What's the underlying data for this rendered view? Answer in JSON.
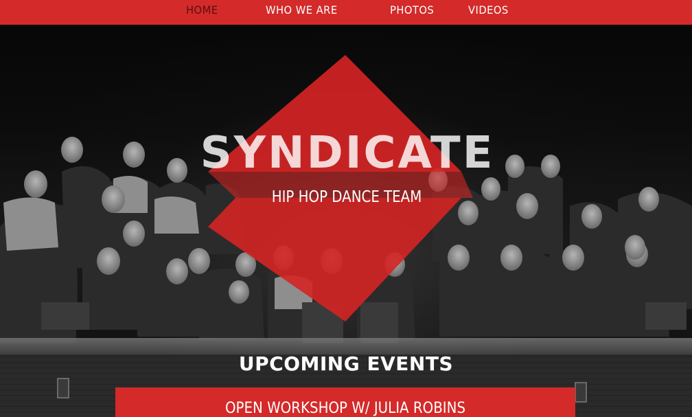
{
  "nav": {
    "items": [
      {
        "label": "HOME",
        "active": true
      },
      {
        "label": "WHO WE ARE",
        "active": false
      },
      {
        "label": "PHOTOS",
        "active": false
      },
      {
        "label": "VIDEOS",
        "active": false
      }
    ]
  },
  "hero": {
    "title": "SYNDICATE",
    "subtitle": "HIP HOP DANCE TEAM",
    "background": "black-and-white group photo of dancers on a stage"
  },
  "events": {
    "heading": "UPCOMING EVENTS",
    "items": [
      {
        "title": "OPEN WORKSHOP W/ JULIA ROBINS"
      }
    ]
  },
  "colors": {
    "accent": "#d42a2a",
    "nav_active_text": "#5a1010",
    "text": "#ffffff"
  }
}
